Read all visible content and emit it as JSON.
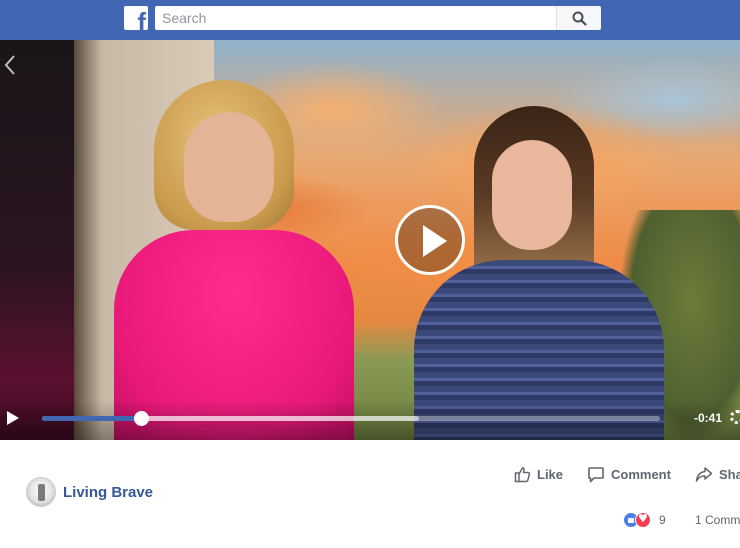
{
  "header": {
    "search_placeholder": "Search",
    "brand_letter": "f",
    "brand_color": "#4267b2"
  },
  "video": {
    "time_remaining": "-0:41",
    "progress_played_pct": 16,
    "progress_buffered_pct": 61
  },
  "post": {
    "page_name": "Living Brave",
    "actions": {
      "like_label": "Like",
      "comment_label": "Comment",
      "share_label": "Sha"
    },
    "reactions_count": "9",
    "comments_count": "1 Comm"
  }
}
